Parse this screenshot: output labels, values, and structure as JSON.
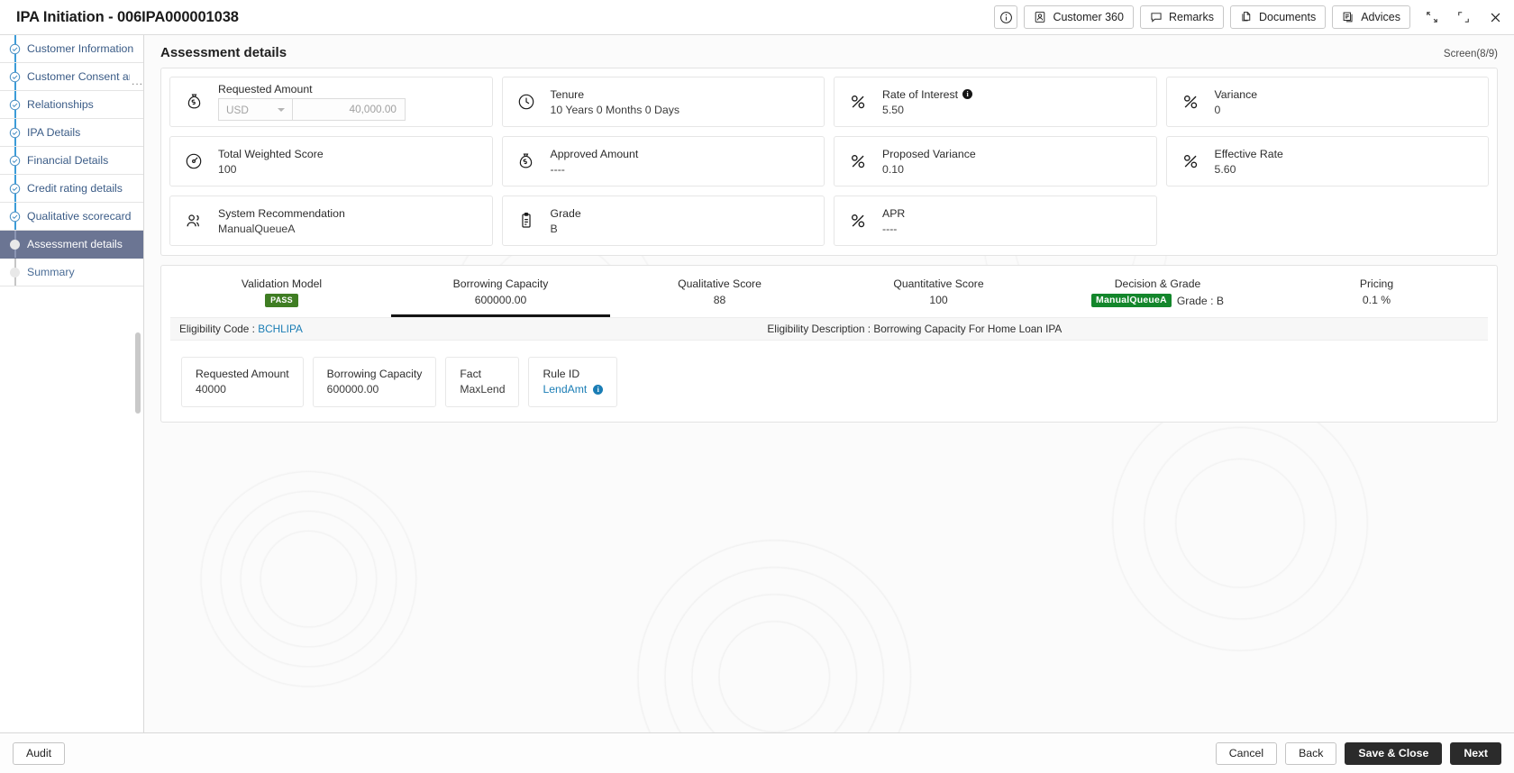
{
  "window": {
    "title": "IPA Initiation - 006IPA000001038",
    "actions": [
      {
        "id": "info",
        "icon": "info-circle-icon",
        "label": ""
      },
      {
        "id": "customer360",
        "icon": "user-card-icon",
        "label": "Customer 360"
      },
      {
        "id": "remarks",
        "icon": "comment-icon",
        "label": "Remarks"
      },
      {
        "id": "documents",
        "icon": "documents-icon",
        "label": "Documents"
      },
      {
        "id": "advices",
        "icon": "advices-icon",
        "label": "Advices"
      }
    ],
    "minimize_icon": "collapse-icon",
    "expand_icon": "expand-icon",
    "close_icon": "close-icon"
  },
  "sidebar": {
    "items": [
      {
        "label": "Customer Information",
        "state": "done"
      },
      {
        "label": "Customer Consent and",
        "state": "done",
        "truncated": "..."
      },
      {
        "label": "Relationships",
        "state": "done"
      },
      {
        "label": "IPA Details",
        "state": "done"
      },
      {
        "label": "Financial Details",
        "state": "done"
      },
      {
        "label": "Credit rating details",
        "state": "done"
      },
      {
        "label": "Qualitative scorecard",
        "state": "done"
      },
      {
        "label": "Assessment details",
        "state": "current"
      },
      {
        "label": "Summary",
        "state": "pending"
      }
    ]
  },
  "main": {
    "page_title": "Assessment details",
    "screen_counter": "Screen(8/9)",
    "cards": [
      {
        "label": "Requested Amount",
        "icon": "money-bag-icon",
        "type": "amount-input",
        "currency": "USD",
        "amount": "40,000.00"
      },
      {
        "label": "Tenure",
        "icon": "clock-icon",
        "value": "10 Years 0 Months 0 Days"
      },
      {
        "label": "Rate of Interest",
        "icon": "percent-icon",
        "value": "5.50",
        "info": true
      },
      {
        "label": "Variance",
        "icon": "percent-icon",
        "value": "0"
      },
      {
        "label": "Total Weighted Score",
        "icon": "gauge-icon",
        "value": "100"
      },
      {
        "label": "Approved Amount",
        "icon": "money-bag-icon",
        "value": "----"
      },
      {
        "label": "Proposed Variance",
        "icon": "percent-icon",
        "value": "0.10"
      },
      {
        "label": "Effective Rate",
        "icon": "percent-icon",
        "value": "5.60"
      },
      {
        "label": "System Recommendation",
        "icon": "users-icon",
        "value": "ManualQueueA"
      },
      {
        "label": "Grade",
        "icon": "clipboard-icon",
        "value": "B"
      },
      {
        "label": "APR",
        "icon": "percent-icon",
        "value": "----"
      }
    ],
    "tabs": [
      {
        "label": "Validation Model",
        "value": "",
        "badge": "PASS",
        "badge_style": "pass",
        "active": false
      },
      {
        "label": "Borrowing Capacity",
        "value": "600000.00",
        "active": true
      },
      {
        "label": "Qualitative Score",
        "value": "88",
        "active": false
      },
      {
        "label": "Quantitative Score",
        "value": "100",
        "active": false
      },
      {
        "label": "Decision & Grade",
        "value": "Grade : B",
        "badge": "ManualQueueA",
        "badge_style": "decision",
        "active": false
      },
      {
        "label": "Pricing",
        "value": "0.1 %",
        "active": false
      }
    ],
    "eligibility": {
      "code_label": "Eligibility Code :",
      "code_value": "BCHLIPA",
      "description": "Eligibility Description : Borrowing Capacity For Home Loan IPA"
    },
    "facts": [
      {
        "label": "Requested Amount",
        "value": "40000"
      },
      {
        "label": "Borrowing Capacity",
        "value": "600000.00"
      },
      {
        "label": "Fact",
        "value": "MaxLend"
      },
      {
        "label": "Rule ID",
        "value": "LendAmt",
        "link": true,
        "info": true
      }
    ]
  },
  "footer": {
    "audit": "Audit",
    "cancel": "Cancel",
    "back": "Back",
    "save_close": "Save & Close",
    "next": "Next"
  },
  "colors": {
    "accent_link": "#1a7db5",
    "pass_green": "#3f7d23",
    "decision_green": "#13862b",
    "current_step": "#6b7593",
    "dark_button": "#2b2b2b"
  }
}
